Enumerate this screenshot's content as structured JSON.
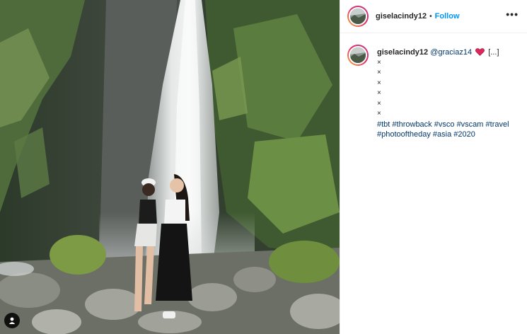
{
  "header": {
    "username": "giselacindy12",
    "separator": "•",
    "follow_label": "Follow",
    "more_label": "•••"
  },
  "caption": {
    "username": "giselacindy12",
    "mention": "@graciaz14",
    "more_label": "[...]",
    "lines": [
      "×",
      "×",
      "×",
      "×",
      "×",
      "×"
    ],
    "hashtags_line1": [
      "#tbt",
      "#throwback",
      "#vsco",
      "#vscam",
      "#travel"
    ],
    "hashtags_line2": [
      "#photooftheday",
      "#asia",
      "#2020"
    ]
  },
  "icons": {
    "heart": "red-heart-icon",
    "tag": "user-tag-icon",
    "more": "more-options-icon"
  },
  "colors": {
    "follow": "#0095f6",
    "hashtag": "#00376b",
    "heart": "#e0245e"
  }
}
